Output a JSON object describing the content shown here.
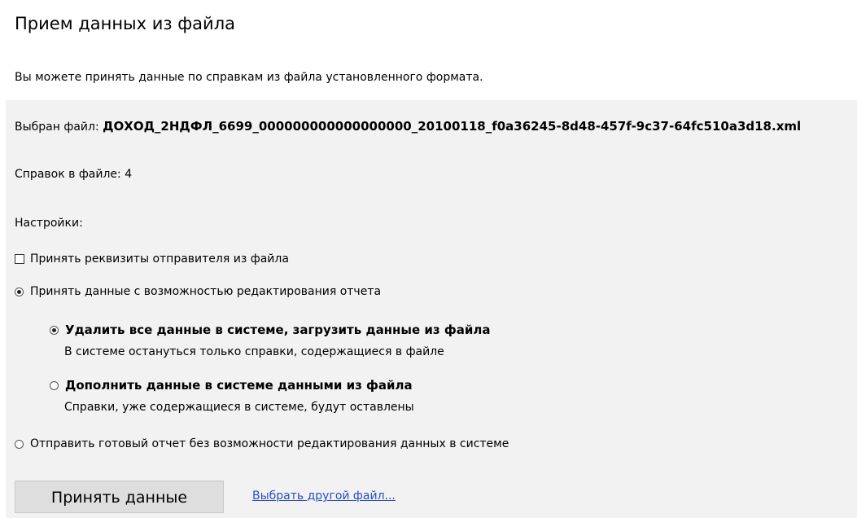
{
  "title": "Прием данных из файла",
  "intro": "Вы можете принять данные по справкам из файла установленного формата.",
  "file": {
    "label": "Выбран файл:",
    "name": "ДОХОД_2НДФЛ_6699_000000000000000000_20100118_f0a36245-8d48-457f-9c37-64fc510a3d18.xml"
  },
  "count_text": "Справок в файле: 4",
  "settings_label": "Настройки:",
  "options": {
    "sender_checkbox": {
      "label": "Принять реквизиты отправителя из файла",
      "checked": false
    },
    "edit_radio": {
      "label": "Принять данные с возможностью редактирования отчета",
      "selected": true
    },
    "replace_radio": {
      "title": "Удалить все данные в системе, загрузить данные из файла",
      "desc": "В системе остануться только справки, содержащиеся в файле",
      "selected": true
    },
    "append_radio": {
      "title": "Дополнить данные в системе данными из файла",
      "desc": "Справки, уже содержащиеся в системе, будут оставлены",
      "selected": false
    },
    "send_radio": {
      "label": "Отправить готовый отчет без возможности редактирования данных в системе",
      "selected": false
    }
  },
  "actions": {
    "accept_label": "Принять данные",
    "other_file_label": "Выбрать другой файл..."
  }
}
